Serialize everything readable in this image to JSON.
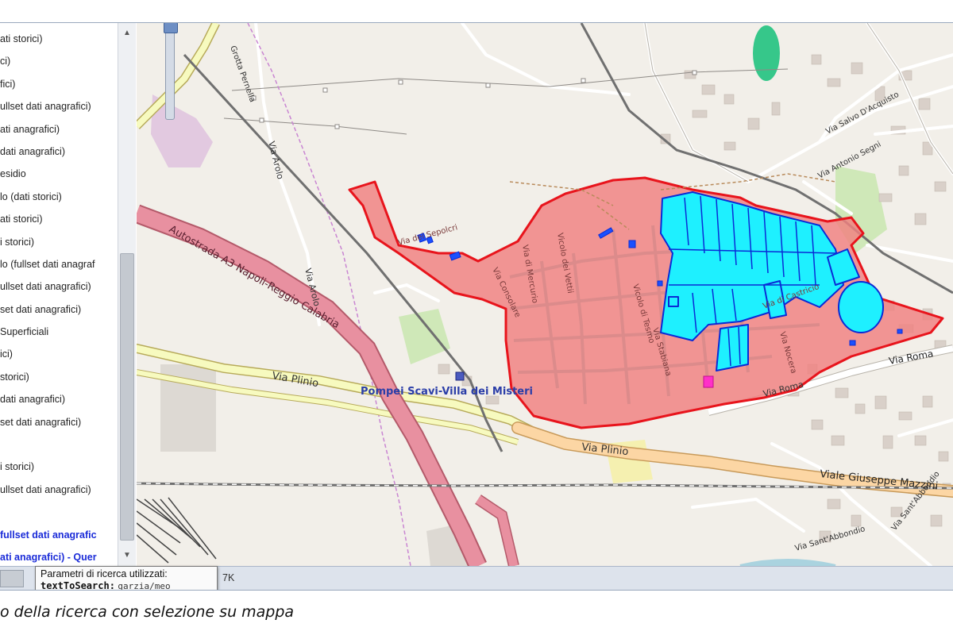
{
  "layer_panel": {
    "items": [
      {
        "label": "ati storici)"
      },
      {
        "label": "ci)"
      },
      {
        "label": "fici)"
      },
      {
        "label": "ullset dati anagrafici)"
      },
      {
        "label": "ati anagrafici)"
      },
      {
        "label": "dati anagrafici)"
      },
      {
        "label": "esidio"
      },
      {
        "label": "lo (dati storici)"
      },
      {
        "label": "ati storici)"
      },
      {
        "label": "i storici)"
      },
      {
        "label": "lo (fullset dati anagraf"
      },
      {
        "label": "ullset dati anagrafici)"
      },
      {
        "label": "set dati anagrafici)"
      },
      {
        "label": "Superficiali"
      },
      {
        "label": "ici)"
      },
      {
        "label": "storici)"
      },
      {
        "label": "dati anagrafici)"
      },
      {
        "label": "set dati anagrafici)"
      },
      {
        "label": ""
      },
      {
        "label": "i storici)"
      },
      {
        "label": "ullset dati anagrafici)"
      },
      {
        "label": ""
      },
      {
        "label": "fullset dati anagrafic",
        "highlight": true
      },
      {
        "label": "ati anagrafici) - Quer",
        "highlight": true
      }
    ]
  },
  "map": {
    "labels": {
      "via_plinio_west": "Via Plinio",
      "via_plinio_south": "Via Plinio",
      "viale_mazzini": "Viale Giuseppe Mazzini",
      "via_roma": "Via Roma",
      "via_roma_2": "Via Roma",
      "autostrada": "Autostrada A3 Napoli-Reggio Calabria",
      "via_arolo_1": "Via Arolo",
      "via_arolo_2": "Via Arolo",
      "grotta_pernella": "Grotta Pernella",
      "station": "Pompei Scavi-Villa dei Misteri",
      "via_salvo": "Via Salvo D'Acquisto",
      "via_segni": "Via Antonio Segni",
      "via_abbondio": "Via Sant'Abbondio",
      "via_abbondio_2": "Via Sant'Abbondio",
      "vicolo_mercurio": "Via di Mercurio",
      "vicolo_vettii": "Vicolo dei Vettii",
      "via_consolare": "Via Consolare",
      "via_stabiana": "Via Stabiana",
      "via_nocera": "Via Nocera",
      "via_castricio": "Via di Castricio",
      "via_sepolcri": "Via dei Sepolcri",
      "vicolo_tesmo": "Vicolo di Tesmo"
    },
    "colors": {
      "selection_fill": "#f08080",
      "selection_border": "#e8141c",
      "query_result": "#1ef0ff",
      "query_result_border": "#0a2bd6",
      "highlight_point": "#ff30c8"
    }
  },
  "status_bar": {
    "tooltip_title": "Parametri di ricerca utilizzati:",
    "tooltip_key": "textToSearch:",
    "tooltip_value": "garzia/meo",
    "suffix": "7K"
  },
  "caption": "o  della ricerca con selezione su mappa"
}
